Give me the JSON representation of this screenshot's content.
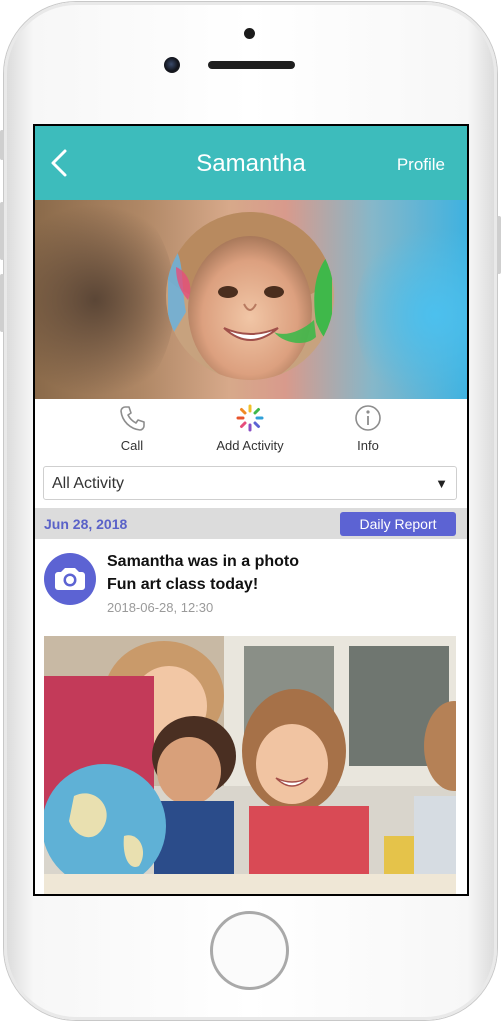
{
  "header": {
    "title": "Samantha",
    "profile_label": "Profile"
  },
  "actions": [
    {
      "label": "Call",
      "icon": "phone-icon"
    },
    {
      "label": "Add Activity",
      "icon": "add-activity-icon"
    },
    {
      "label": "Info",
      "icon": "info-icon"
    }
  ],
  "filter": {
    "selected": "All Activity"
  },
  "feed": {
    "date": "Jun 28, 2018",
    "report_button": "Daily Report",
    "entry": {
      "title": "Samantha was in a photo",
      "caption": "Fun art class today!",
      "timestamp": "2018-06-28, 12:30",
      "icon": "camera-icon"
    }
  },
  "colors": {
    "accent": "#3dbcbc",
    "primary": "#5c63d3",
    "date_text": "#5a62c8"
  }
}
